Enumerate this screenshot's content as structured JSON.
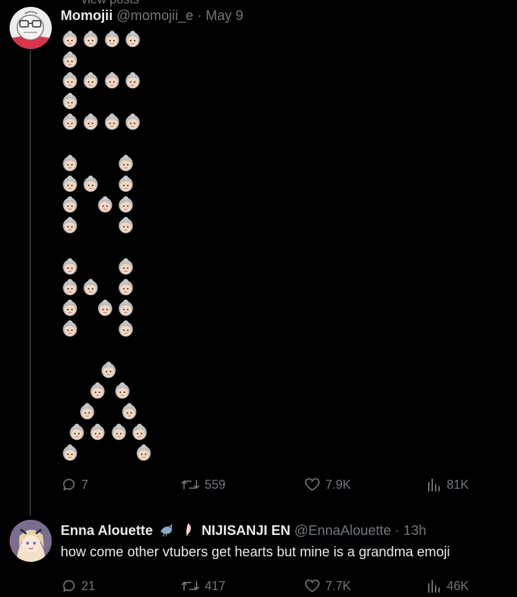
{
  "context": {
    "cut_label": "view posts"
  },
  "tweet1": {
    "name": "Momojii",
    "handle": "@momojii_e",
    "separator": "·",
    "time": "May 9",
    "content_emoji": "👵🏻",
    "stats": {
      "replies": "7",
      "reposts": "559",
      "likes": "7.9K",
      "views": "81K"
    }
  },
  "tweet2": {
    "name": "Enna Alouette",
    "affiliation": "NIJISANJI EN",
    "handle": "@EnnaAlouette",
    "separator": "·",
    "time": "13h",
    "text": "how come other vtubers get hearts but mine is a grandma emoji",
    "badges": [
      "bird-icon",
      "feather-icon"
    ],
    "stats": {
      "replies": "21",
      "reposts": "417",
      "likes": "7.7K",
      "views": "46K"
    }
  },
  "colors": {
    "background": "#000000",
    "text": "#e7e9ea",
    "muted": "#71767b",
    "thread_line": "#333639"
  }
}
